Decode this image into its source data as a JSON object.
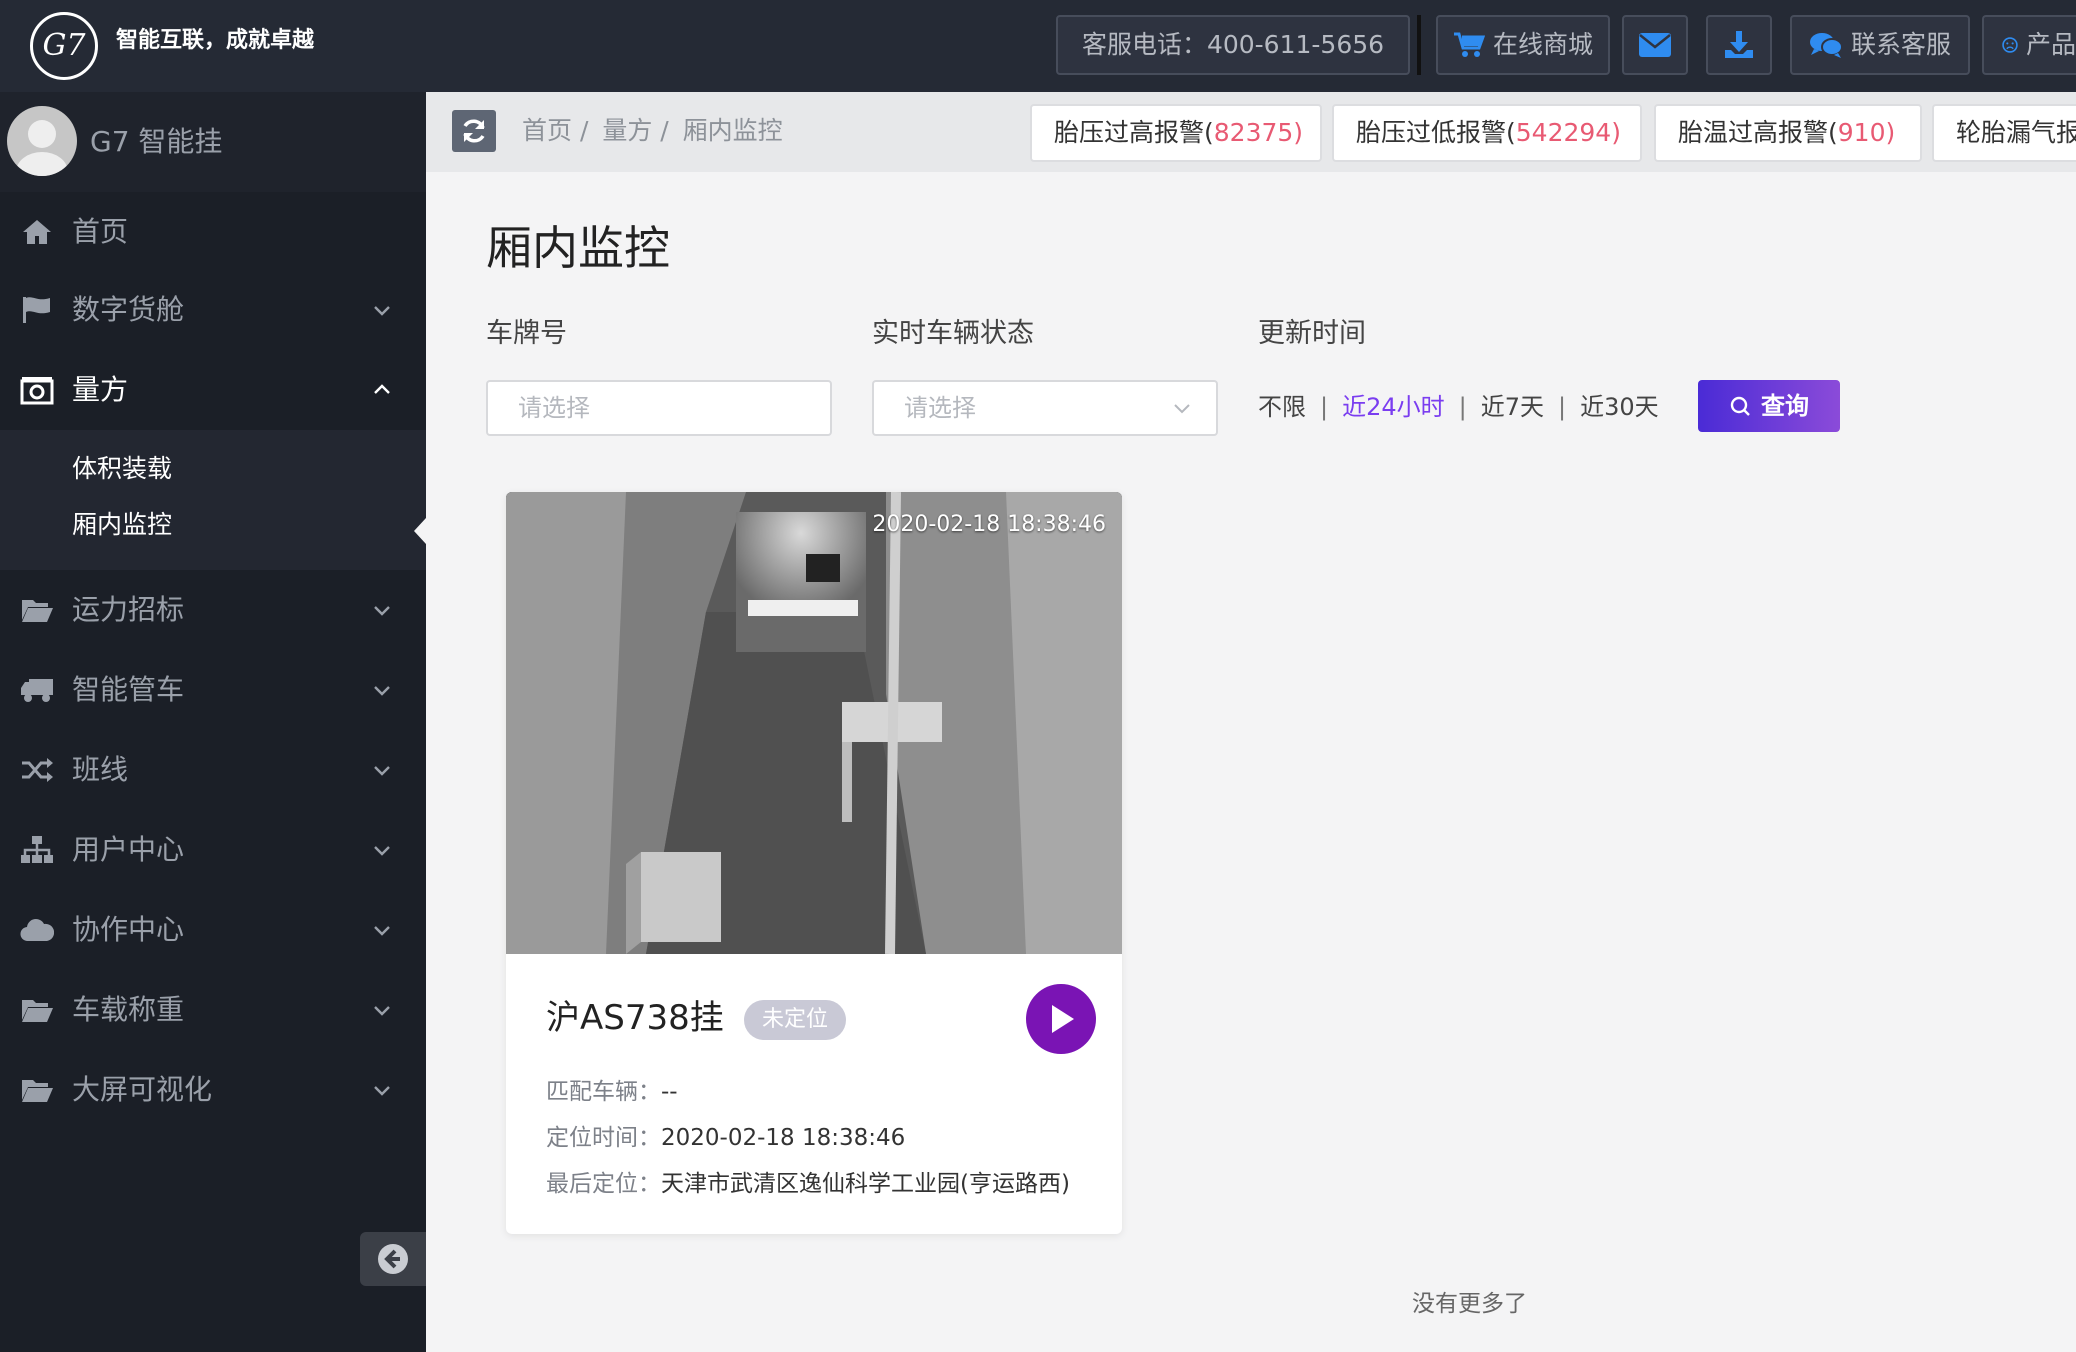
{
  "header": {
    "logo_text": "G7",
    "slogan": "智能互联，成就卓越",
    "hotline": "客服电话：400-611-5656",
    "shop_label": "在线商城",
    "service_label": "联系客服",
    "product_label": "产品"
  },
  "sidebar": {
    "user_name": "G7 智能挂",
    "items": [
      {
        "label": "首页",
        "icon": "home-icon"
      },
      {
        "label": "数字货舱",
        "icon": "flag-icon"
      },
      {
        "label": "量方",
        "icon": "camera-icon"
      },
      {
        "label": "运力招标",
        "icon": "folder-icon"
      },
      {
        "label": "智能管车",
        "icon": "truck-icon"
      },
      {
        "label": "班线",
        "icon": "shuffle-icon"
      },
      {
        "label": "用户中心",
        "icon": "sitemap-icon"
      },
      {
        "label": "协作中心",
        "icon": "cloud-icon"
      },
      {
        "label": "车载称重",
        "icon": "folder-icon"
      },
      {
        "label": "大屏可视化",
        "icon": "folder-icon"
      }
    ],
    "sub_items": [
      {
        "label": "体积装载"
      },
      {
        "label": "厢内监控"
      }
    ]
  },
  "breadcrumb": [
    "首页 /",
    "量方 /",
    "厢内监控"
  ],
  "alerts": [
    {
      "label": "胎压过高报警(",
      "count": "82375",
      "close": ")"
    },
    {
      "label": "胎压过低报警(",
      "count": "542294",
      "close": ")"
    },
    {
      "label": "胎温过高报警(",
      "count": "910",
      "close": ")"
    },
    {
      "label": "轮胎漏气报",
      "count": "",
      "close": ""
    }
  ],
  "page": {
    "title": "厢内监控",
    "filters": {
      "plate_label": "车牌号",
      "plate_placeholder": "请选择",
      "status_label": "实时车辆状态",
      "status_placeholder": "请选择",
      "time_label": "更新时间",
      "time_options": [
        "不限",
        "近24小时",
        "近7天",
        "近30天"
      ],
      "time_selected": "近24小时"
    },
    "query_label": "查询",
    "no_more": "没有更多了"
  },
  "card": {
    "timestamp": "2020-02-18 18:38:46",
    "plate": "沪AS738挂",
    "badge": "未定位",
    "rows": [
      {
        "key": "匹配车辆：",
        "value": "--"
      },
      {
        "key": "定位时间：",
        "value": "2020-02-18 18:38:46"
      },
      {
        "key": "最后定位：",
        "value": "天津市武清区逸仙科学工业园(亨运路西)"
      }
    ]
  },
  "colors": {
    "topbar": "#252a35",
    "sidebar": "#1b1f27",
    "accent_purple": "#7a3df0",
    "play_button": "#7a14b4",
    "alert_count": "#e85a73",
    "icon_blue": "#2f8cf0"
  }
}
